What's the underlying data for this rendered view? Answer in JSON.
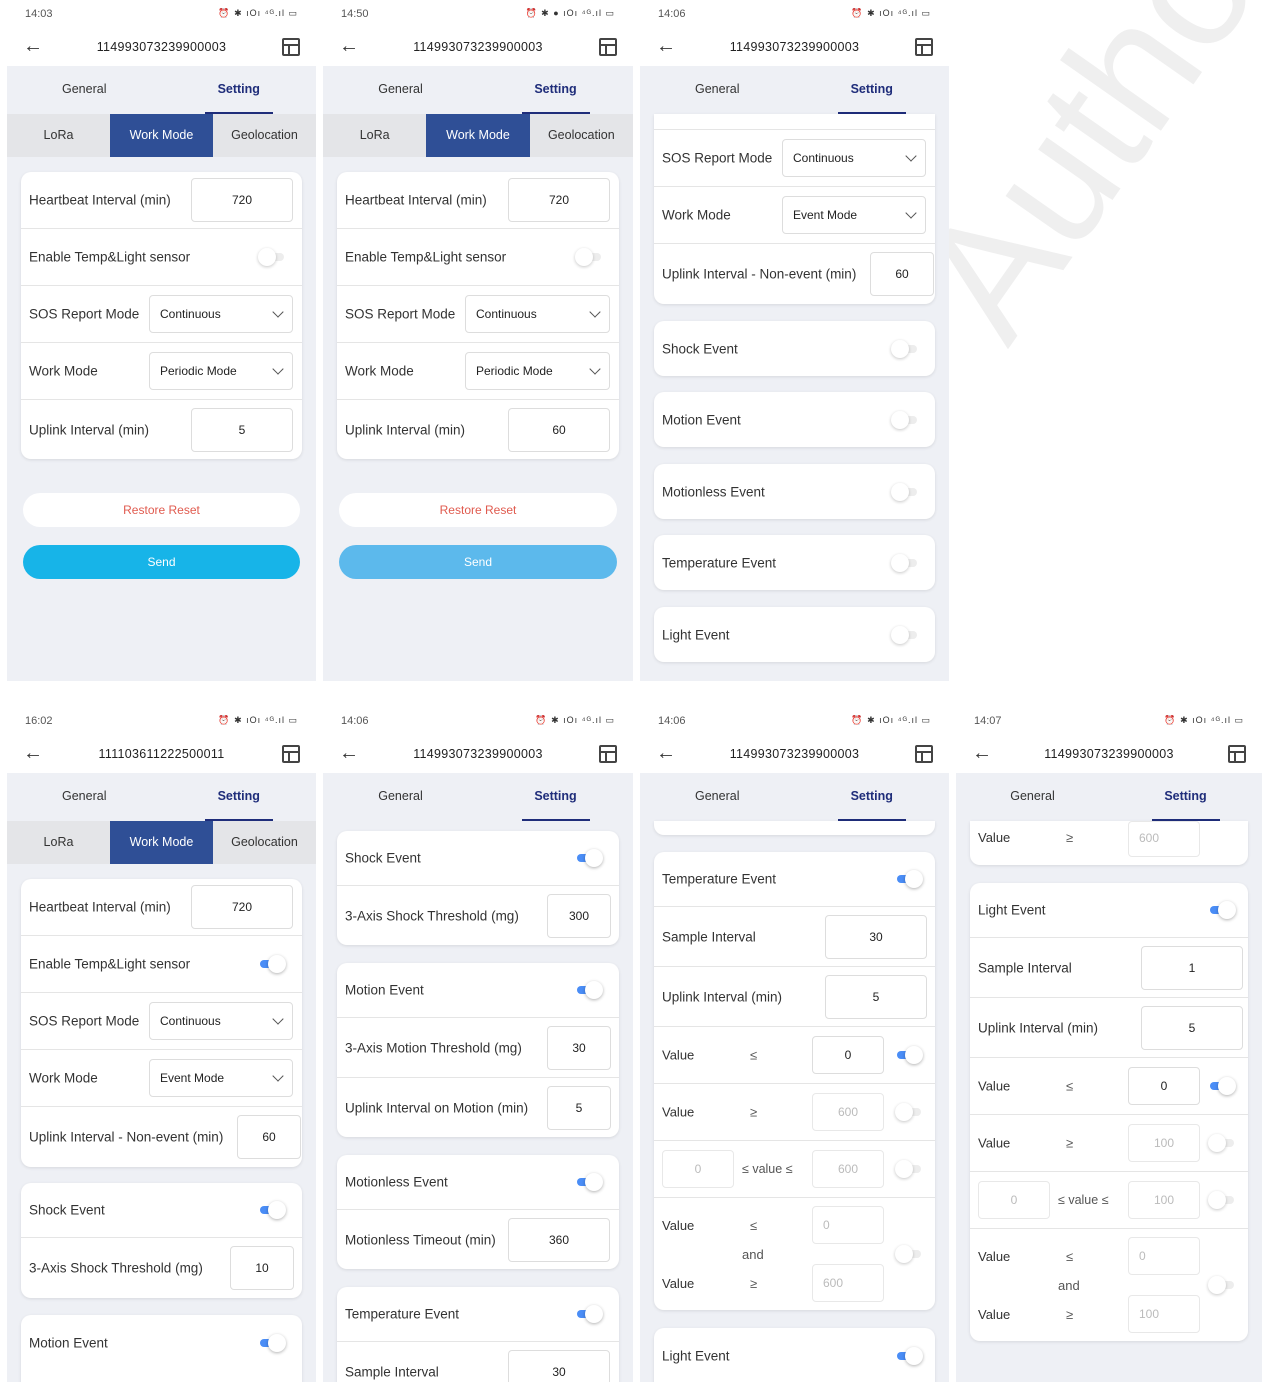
{
  "device_id": "114993073239900003",
  "device_id_b": "111103611222500011",
  "tab_general": "General",
  "tab_setting": "Setting",
  "sub_lora": "LoRa",
  "sub_work": "Work Mode",
  "sub_geo": "Geolocation",
  "watermark": "Authorised",
  "labels": {
    "heartbeat": "Heartbeat Interval (min)",
    "templight": "Enable Temp&Light sensor",
    "sos": "SOS Report Mode",
    "workmode": "Work Mode",
    "uplink": "Uplink Interval (min)",
    "uplink_ne": "Uplink Interval - Non-event (min)",
    "shock": "Shock Event",
    "motion": "Motion Event",
    "motionless": "Motionless Event",
    "temp": "Temperature Event",
    "light": "Light Event",
    "shock_th": "3-Axis Shock Threshold (mg)",
    "motion_th": "3-Axis Motion Threshold (mg)",
    "uplink_motion": "Uplink Interval on Motion (min)",
    "motionless_to": "Motionless Timeout (min)",
    "sample": "Sample Interval",
    "value": "Value",
    "le": "≤",
    "ge": "≥",
    "between": "≤ value ≤",
    "and": "and",
    "restore": "Restore Reset",
    "send": "Send"
  },
  "options": {
    "continuous": "Continuous",
    "periodic": "Periodic Mode",
    "event": "Event Mode"
  },
  "s1": {
    "time": "14:03",
    "icons": "⏰ ✱ ıOı ⁴ᴳ.ıl ▭",
    "hb": "720",
    "up": "5"
  },
  "s2": {
    "time": "14:50",
    "icons": "⏰ ✱ ● ıOı ⁴ᴳ.ıl ▭",
    "hb": "720",
    "up": "60"
  },
  "s3": {
    "time": "14:06",
    "icons": "⏰ ✱ ıOı ⁴ᴳ.ıl ▭",
    "up": "60"
  },
  "s4": {
    "time": "16:02",
    "icons": "⏰ ✱ ıOı ⁴ᴳ.ıl ▭",
    "hb": "720",
    "up": "60",
    "shock_th": "10"
  },
  "s5": {
    "time": "14:06",
    "icons": "⏰ ✱ ıOı ⁴ᴳ.ıl ▭",
    "shock_th": "300",
    "motion_th": "30",
    "up_motion": "5",
    "timeout": "360",
    "sample": "30"
  },
  "s6": {
    "time": "14:06",
    "icons": "⏰ ✱ ıOı ⁴ᴳ.ıl ▭",
    "sample": "30",
    "up": "5",
    "v1": "0",
    "v2": "600",
    "b1": "0",
    "b2": "600",
    "a1": "0",
    "a2": "600"
  },
  "s7": {
    "time": "14:07",
    "icons": "⏰ ✱ ıOı ⁴ᴳ.ıl ▭",
    "top": "600",
    "sample": "1",
    "up": "5",
    "v1": "0",
    "v2": "100",
    "b1": "0",
    "b2": "100",
    "a1": "0",
    "a2": "100"
  }
}
